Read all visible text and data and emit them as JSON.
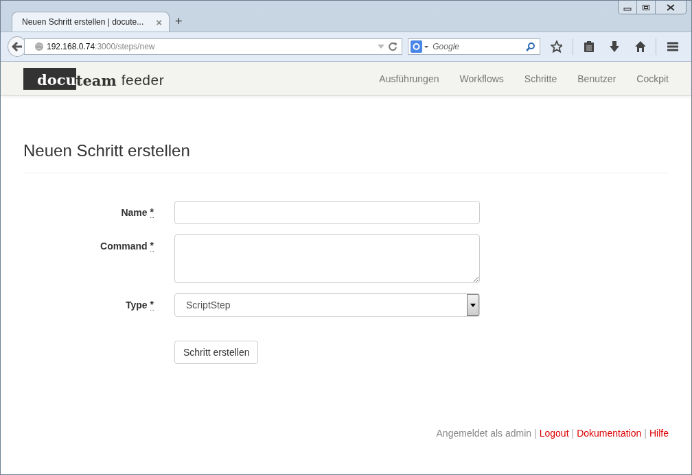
{
  "browser": {
    "tab": {
      "title": "Neuen Schritt erstellen | docute...",
      "close": "×"
    },
    "new_tab": "+",
    "url_host": "192.168.0.74",
    "url_path": ":3000/steps/new",
    "search_placeholder": "Google"
  },
  "brand": {
    "dark": "docu",
    "light": "team",
    "suffix": "feeder"
  },
  "nav": [
    {
      "label": "Ausführungen"
    },
    {
      "label": "Workflows"
    },
    {
      "label": "Schritte"
    },
    {
      "label": "Benutzer"
    },
    {
      "label": "Cockpit"
    }
  ],
  "heading": "Neuen Schritt erstellen",
  "fields": [
    {
      "kind": "text",
      "label": "Name",
      "required": "*"
    },
    {
      "kind": "textarea",
      "label": "Command",
      "required": "*"
    },
    {
      "kind": "select",
      "label": "Type",
      "required": "*",
      "value": "ScriptStep"
    }
  ],
  "submit": "Schritt erstellen",
  "footer": [
    {
      "kind": "text",
      "text": "Angemeldet als admin"
    },
    {
      "kind": "sep",
      "text": "|"
    },
    {
      "kind": "link",
      "text": "Logout"
    },
    {
      "kind": "sep",
      "text": "|"
    },
    {
      "kind": "link",
      "text": "Dokumentation"
    },
    {
      "kind": "sep",
      "text": "|"
    },
    {
      "kind": "link",
      "text": "Hilfe"
    }
  ]
}
